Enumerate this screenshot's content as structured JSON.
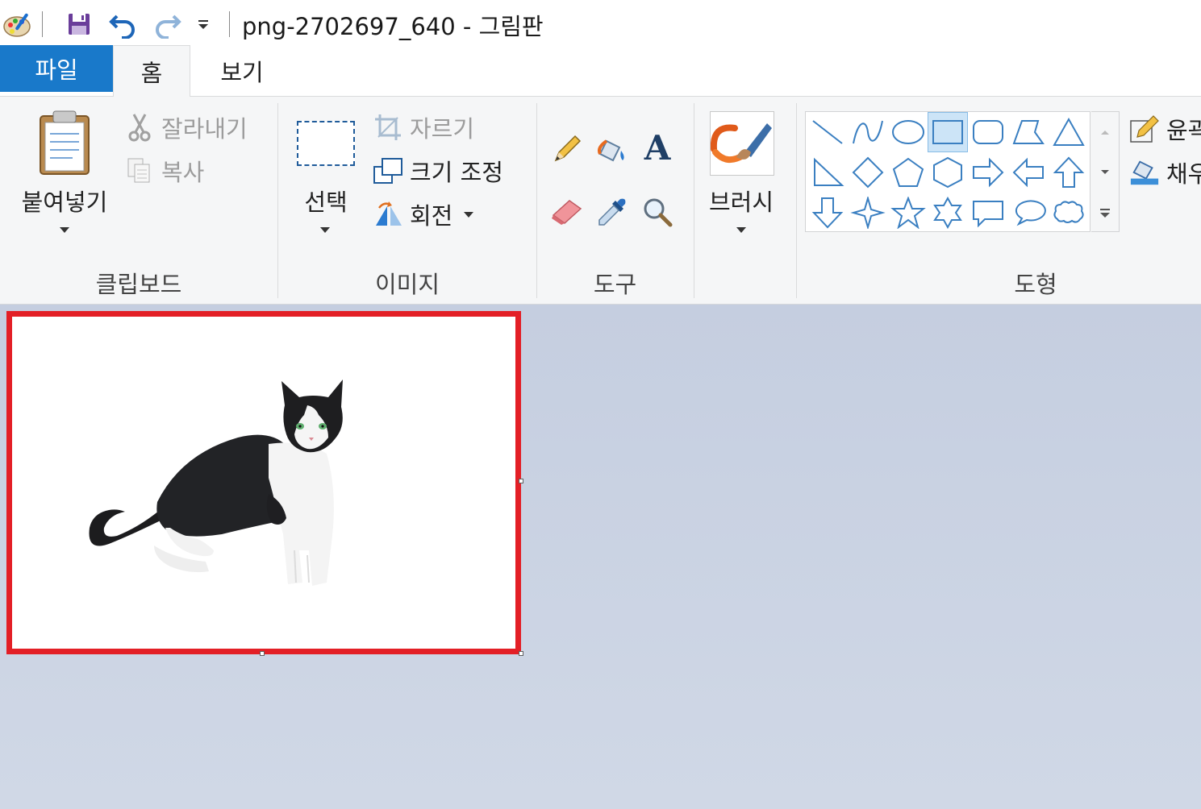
{
  "window": {
    "title": "png-2702697_640 - 그림판"
  },
  "qat": {
    "icons": [
      "paint-app-icon",
      "save-icon",
      "undo-icon",
      "redo-icon",
      "customize-dropdown-icon"
    ]
  },
  "tabs": {
    "file": "파일",
    "home": "홈",
    "view": "보기"
  },
  "ribbon": {
    "clipboard": {
      "paste": "붙여넣기",
      "cut": "잘라내기",
      "copy": "복사",
      "group_label": "클립보드"
    },
    "image": {
      "select": "선택",
      "crop": "자르기",
      "resize": "크기 조정",
      "rotate": "회전",
      "group_label": "이미지"
    },
    "tools": {
      "group_label": "도구",
      "items": [
        "pencil-icon",
        "fill-bucket-icon",
        "text-icon",
        "eraser-icon",
        "color-picker-icon",
        "magnifier-icon"
      ],
      "text_glyph": "A"
    },
    "brushes": {
      "label": "브러시"
    },
    "shapes": {
      "group_label": "도형",
      "outline": "윤곽선",
      "fill": "채우기",
      "selected": "rectangle"
    }
  },
  "canvas": {
    "image_alt": "cat-image"
  },
  "colors": {
    "accent": "#1979ca",
    "selection_border": "#e31f26",
    "ribbon_bg": "#f5f6f7",
    "workspace_bg": "#c9d2e3",
    "shape_stroke": "#3a7fc1"
  }
}
